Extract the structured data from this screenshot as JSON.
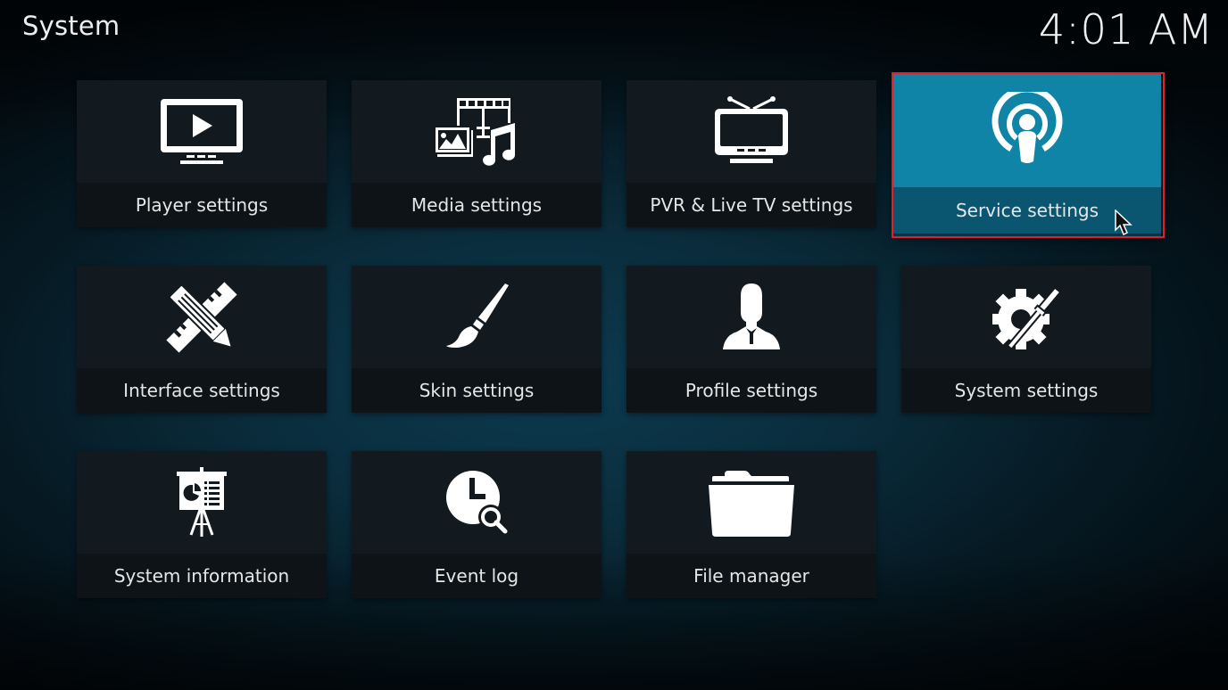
{
  "header": {
    "title": "System",
    "clock": "4:01 AM"
  },
  "tiles": [
    {
      "label": "Player settings",
      "icon": "monitor-play-icon"
    },
    {
      "label": "Media settings",
      "icon": "media-library-icon"
    },
    {
      "label": "PVR & Live TV settings",
      "icon": "tv-antenna-icon"
    },
    {
      "label": "Service settings",
      "icon": "podcast-broadcast-icon",
      "focused": true
    },
    {
      "label": "Interface settings",
      "icon": "pencil-ruler-icon"
    },
    {
      "label": "Skin settings",
      "icon": "paintbrush-icon"
    },
    {
      "label": "Profile settings",
      "icon": "user-profile-icon"
    },
    {
      "label": "System settings",
      "icon": "gear-screwdriver-icon"
    },
    {
      "label": "System information",
      "icon": "presentation-easel-icon"
    },
    {
      "label": "Event log",
      "icon": "clock-search-icon"
    },
    {
      "label": "File manager",
      "icon": "folder-icon"
    }
  ],
  "colors": {
    "focus_tile": "#0f84a6",
    "focus_band": "#0a5671",
    "focus_outline": "#e0202a",
    "tile_bg": "#121a1f"
  }
}
